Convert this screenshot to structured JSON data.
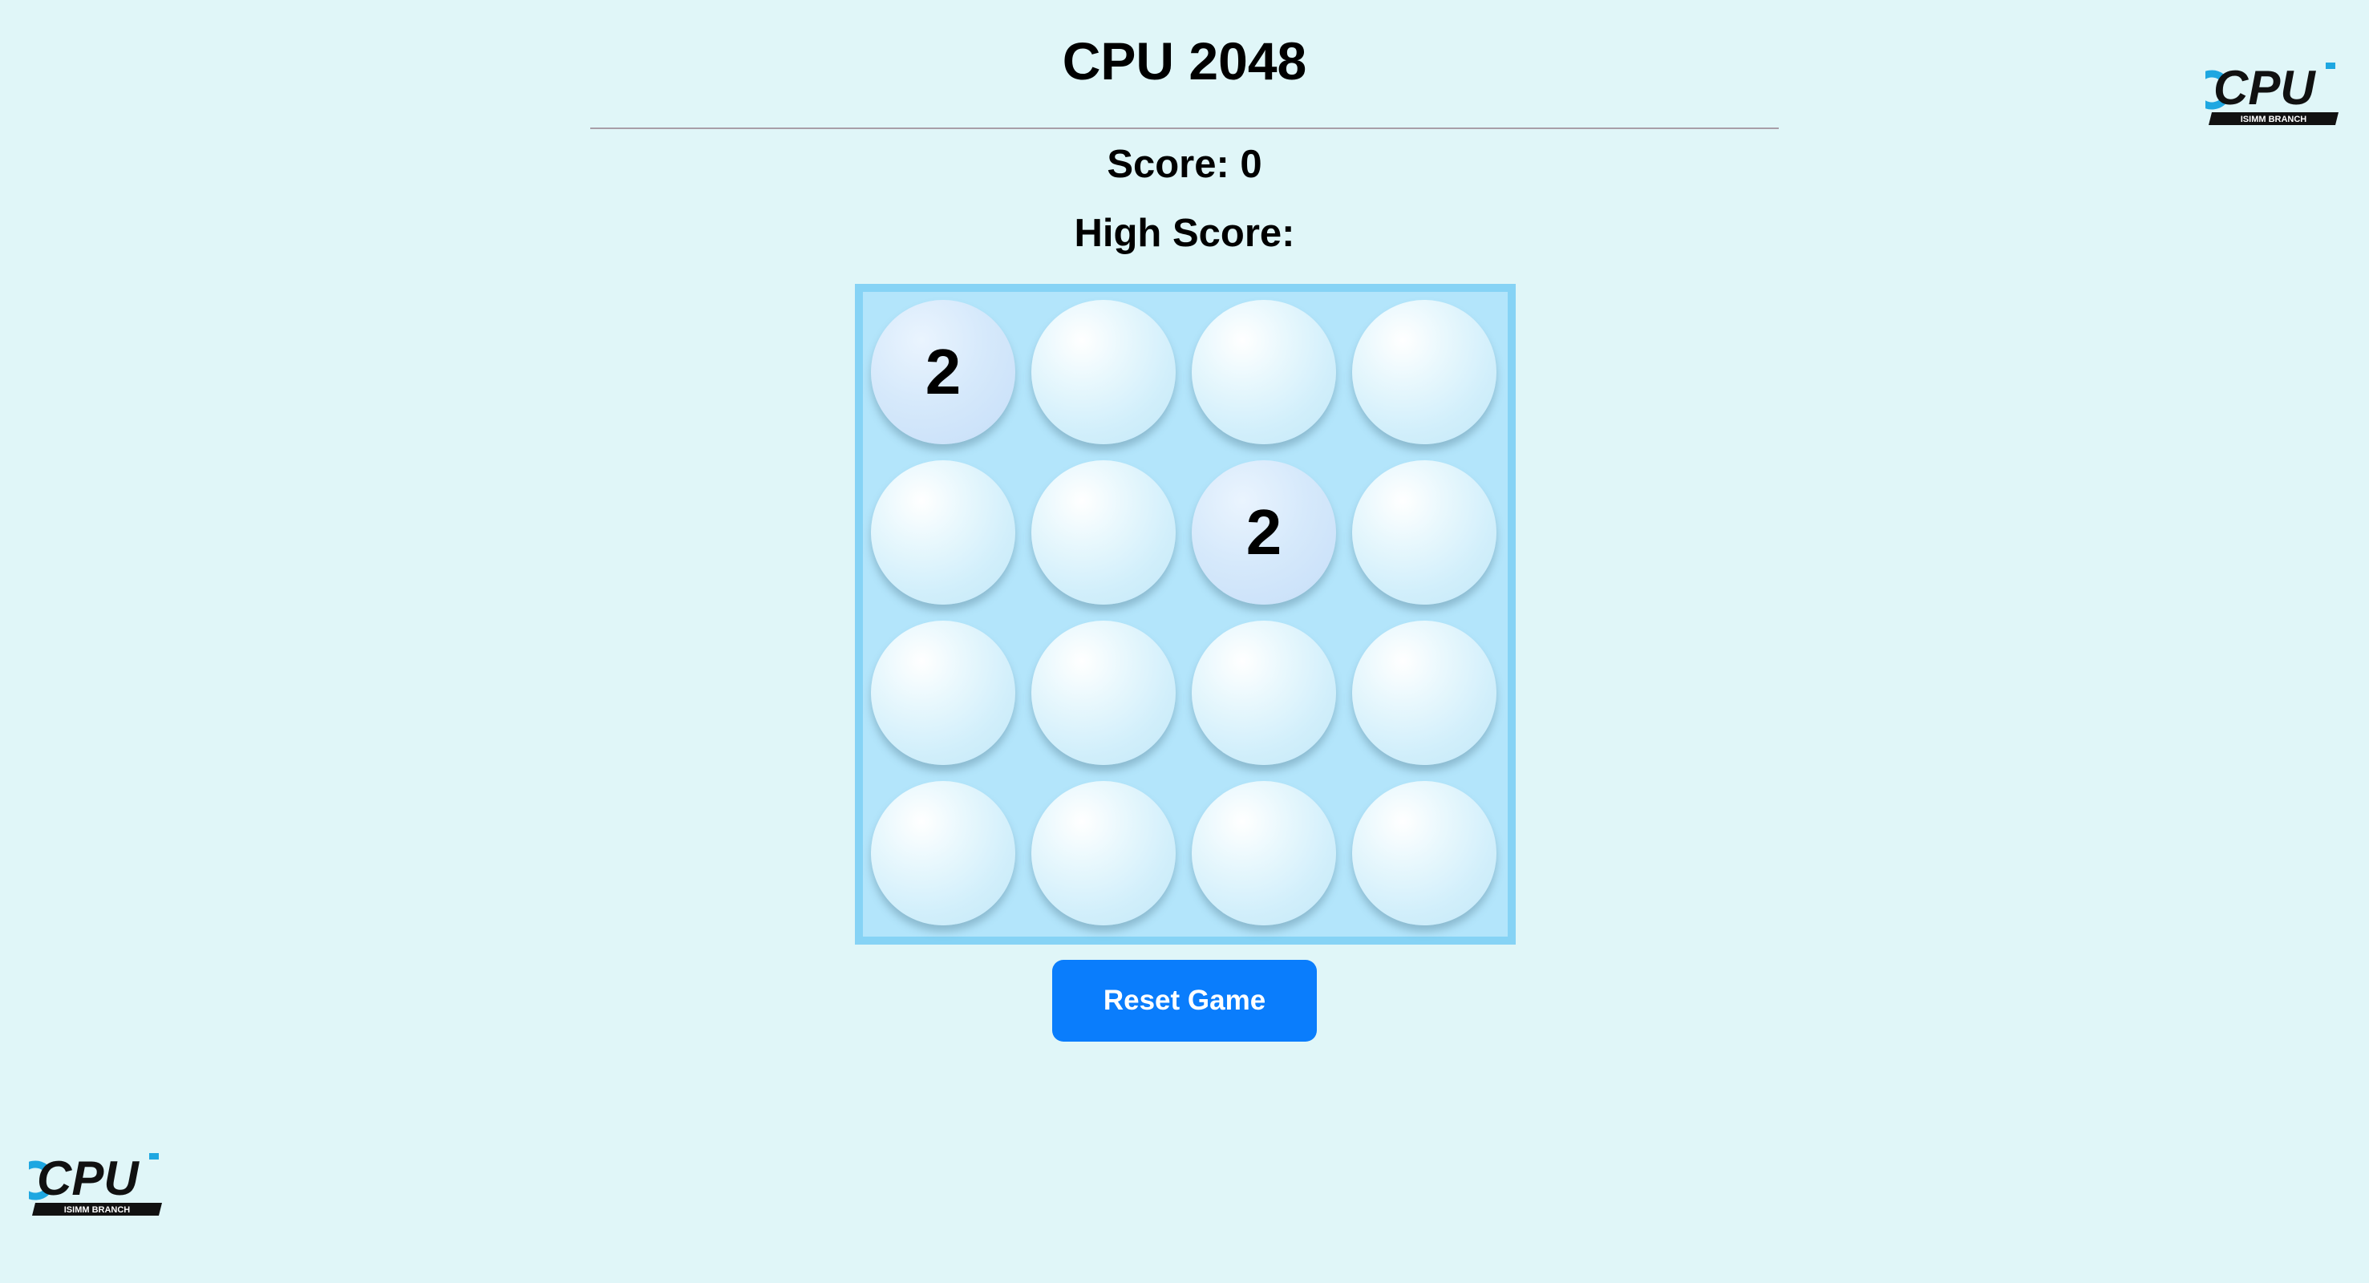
{
  "title": "CPU 2048",
  "score": {
    "label": "Score: 0",
    "value": 0
  },
  "high_score": {
    "label": "High Score:"
  },
  "board": {
    "rows": [
      [
        "2",
        "",
        "",
        ""
      ],
      [
        "",
        "",
        "2",
        ""
      ],
      [
        "",
        "",
        "",
        ""
      ],
      [
        "",
        "",
        "",
        ""
      ]
    ]
  },
  "reset_button": {
    "label": "Reset Game"
  },
  "logo": {
    "text": "CPU",
    "subtext": "ISIMM BRANCH"
  },
  "colors": {
    "background": "#e0f6f8",
    "board": "#b3e5fb",
    "board_border": "#86d3f5",
    "button": "#0a7dfc",
    "logo_accent": "#1ea7e1"
  }
}
